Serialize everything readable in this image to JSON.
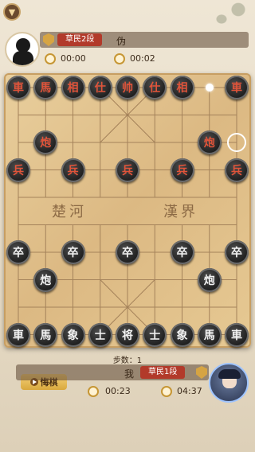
{
  "opponent": {
    "name": "伪",
    "rank": "草民2段",
    "move_time": "00:00",
    "total_time": "00:02"
  },
  "me": {
    "name": "我",
    "rank": "草民1段",
    "move_time": "00:23",
    "total_time": "04:37"
  },
  "board": {
    "river_left": "楚河",
    "river_right": "漢界"
  },
  "steps_label": "步数：1",
  "undo_label": "悔棋",
  "pieces": [
    {
      "ch": "車",
      "color": "red",
      "c": 0,
      "r": 0
    },
    {
      "ch": "馬",
      "color": "red",
      "c": 1,
      "r": 0
    },
    {
      "ch": "相",
      "color": "red",
      "c": 2,
      "r": 0
    },
    {
      "ch": "仕",
      "color": "red",
      "c": 3,
      "r": 0
    },
    {
      "ch": "帅",
      "color": "red",
      "c": 4,
      "r": 0
    },
    {
      "ch": "仕",
      "color": "red",
      "c": 5,
      "r": 0
    },
    {
      "ch": "相",
      "color": "red",
      "c": 6,
      "r": 0
    },
    {
      "ch": "車",
      "color": "red",
      "c": 8,
      "r": 0
    },
    {
      "ch": "炮",
      "color": "red",
      "c": 1,
      "r": 2
    },
    {
      "ch": "炮",
      "color": "red",
      "c": 7,
      "r": 2
    },
    {
      "ch": "兵",
      "color": "red",
      "c": 0,
      "r": 3
    },
    {
      "ch": "兵",
      "color": "red",
      "c": 2,
      "r": 3
    },
    {
      "ch": "兵",
      "color": "red",
      "c": 4,
      "r": 3
    },
    {
      "ch": "兵",
      "color": "red",
      "c": 6,
      "r": 3
    },
    {
      "ch": "兵",
      "color": "red",
      "c": 8,
      "r": 3
    },
    {
      "ch": "卒",
      "color": "black",
      "c": 0,
      "r": 6
    },
    {
      "ch": "卒",
      "color": "black",
      "c": 2,
      "r": 6
    },
    {
      "ch": "卒",
      "color": "black",
      "c": 4,
      "r": 6
    },
    {
      "ch": "卒",
      "color": "black",
      "c": 6,
      "r": 6
    },
    {
      "ch": "卒",
      "color": "black",
      "c": 8,
      "r": 6
    },
    {
      "ch": "炮",
      "color": "black",
      "c": 1,
      "r": 7
    },
    {
      "ch": "炮",
      "color": "black",
      "c": 7,
      "r": 7
    },
    {
      "ch": "車",
      "color": "black",
      "c": 0,
      "r": 9
    },
    {
      "ch": "馬",
      "color": "black",
      "c": 1,
      "r": 9
    },
    {
      "ch": "象",
      "color": "black",
      "c": 2,
      "r": 9
    },
    {
      "ch": "士",
      "color": "black",
      "c": 3,
      "r": 9
    },
    {
      "ch": "将",
      "color": "black",
      "c": 4,
      "r": 9
    },
    {
      "ch": "士",
      "color": "black",
      "c": 5,
      "r": 9
    },
    {
      "ch": "象",
      "color": "black",
      "c": 6,
      "r": 9
    },
    {
      "ch": "馬",
      "color": "black",
      "c": 7,
      "r": 9
    },
    {
      "ch": "車",
      "color": "black",
      "c": 8,
      "r": 9
    }
  ],
  "last_move": {
    "from": {
      "c": 7,
      "r": 0
    },
    "to": {
      "c": 8,
      "r": 2
    }
  },
  "icons": [
    "back-icon",
    "shield-rank-icon",
    "timer-icon",
    "undo-icon",
    "avatar"
  ]
}
